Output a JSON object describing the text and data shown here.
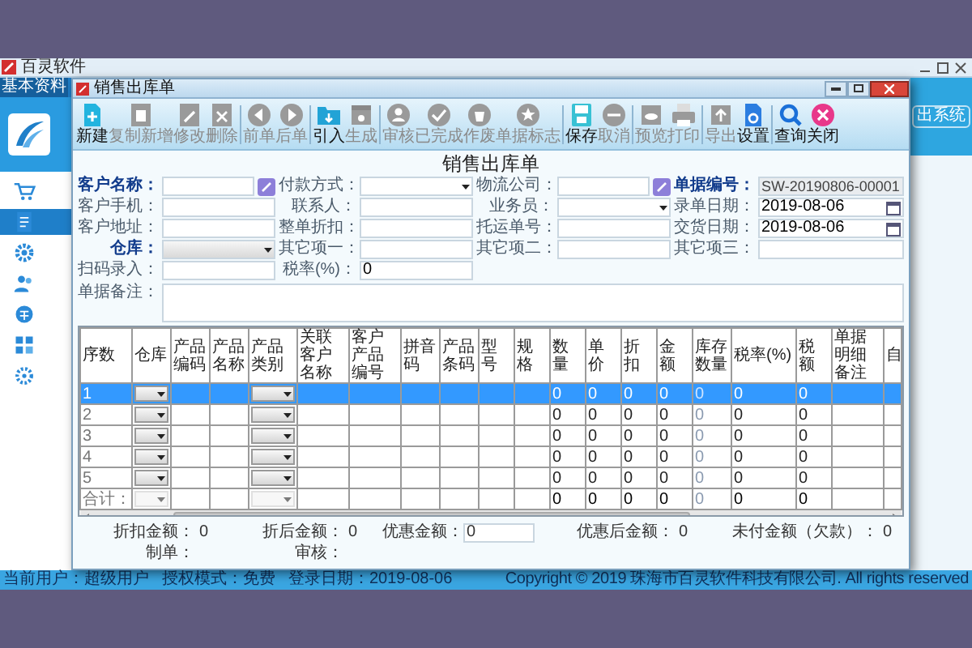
{
  "app": {
    "title": "百灵软件",
    "tab": "基本资料",
    "exit_button": "出系统",
    "sidebar": {
      "items": [
        {
          "selected": false
        },
        {
          "selected": true
        },
        {
          "selected": false
        },
        {
          "selected": false
        },
        {
          "selected": false
        },
        {
          "selected": false
        },
        {
          "selected": false
        }
      ]
    },
    "status_bar": {
      "user": "当前用户：超级用户",
      "mode": "授权模式：免费",
      "login": "登录日期：2019-08-06",
      "copyright": "Copyright © 2019 珠海市百灵软件科技有限公司. All rights reserved"
    }
  },
  "dialog": {
    "title": "销售出库单",
    "toolbar": [
      [
        {
          "label": "新建",
          "disabled": false
        },
        {
          "label": "复制新增",
          "disabled": true
        },
        {
          "label": "修改",
          "disabled": true
        },
        {
          "label": "删除",
          "disabled": true
        }
      ],
      [
        {
          "label": "前单",
          "disabled": true
        },
        {
          "label": "后单",
          "disabled": true
        }
      ],
      [
        {
          "label": "引入",
          "disabled": false
        },
        {
          "label": "生成",
          "disabled": true
        }
      ],
      [
        {
          "label": "审核",
          "disabled": true
        },
        {
          "label": "已完成",
          "disabled": true
        },
        {
          "label": "作废",
          "disabled": true
        },
        {
          "label": "单据标志",
          "disabled": true
        }
      ],
      [
        {
          "label": "保存",
          "disabled": false
        },
        {
          "label": "取消",
          "disabled": true
        }
      ],
      [
        {
          "label": "预览",
          "disabled": true
        },
        {
          "label": "打印",
          "disabled": true
        }
      ],
      [
        {
          "label": "导出",
          "disabled": true
        },
        {
          "label": "设置",
          "disabled": false
        }
      ],
      [
        {
          "label": "查询",
          "disabled": false
        },
        {
          "label": "关闭",
          "disabled": false
        }
      ]
    ],
    "form_title": "销售出库单",
    "fields": [
      {
        "label": "客户名称：",
        "kind": "lookup",
        "required": true
      },
      {
        "label": "付款方式：",
        "kind": "select",
        "required": false
      },
      {
        "label": "物流公司：",
        "kind": "lookup",
        "required": false
      },
      {
        "label": "单据编号：",
        "kind": "readonly",
        "value": "SW-20190806-00001",
        "required": true
      },
      {
        "label": "客户手机：",
        "kind": "text",
        "required": false
      },
      {
        "label": "联系人：",
        "kind": "text",
        "required": false
      },
      {
        "label": "业务员：",
        "kind": "select",
        "required": false
      },
      {
        "label": "录单日期：",
        "kind": "date",
        "value": "2019-08-06",
        "required": false
      },
      {
        "label": "客户地址：",
        "kind": "text",
        "required": false
      },
      {
        "label": "整单折扣：",
        "kind": "text",
        "required": false
      },
      {
        "label": "托运单号：",
        "kind": "text",
        "required": false
      },
      {
        "label": "交货日期：",
        "kind": "date",
        "value": "2019-08-06",
        "required": false
      },
      {
        "label": "仓库：",
        "kind": "combo",
        "required": true
      },
      {
        "label": "其它项一：",
        "kind": "text",
        "required": false
      },
      {
        "label": "其它项二：",
        "kind": "text",
        "required": false
      },
      {
        "label": "其它项三：",
        "kind": "text",
        "required": false
      },
      {
        "label": "扫码录入：",
        "kind": "text",
        "required": false
      },
      {
        "label": "税率(%)：",
        "kind": "text",
        "value": "0",
        "required": false
      }
    ],
    "remark": {
      "label": "单据备注："
    },
    "table": {
      "columns": [
        "序数",
        "仓库",
        "产品编码",
        "产品名称",
        "产品类别",
        "关联客户名称",
        "客户产品编号",
        "拼音码",
        "产品条码",
        "型号",
        "规格",
        "数量",
        "单价",
        "折扣",
        "金额",
        "库存数量",
        "税率(%)",
        "税额",
        "单据明细备注",
        "自"
      ],
      "rows": [
        {
          "number": "1",
          "selected": true,
          "quantity": "0",
          "unit_price": "0",
          "discount": "0",
          "amount": "0",
          "stock": "0",
          "tax_rate": "0",
          "tax": "0"
        },
        {
          "number": "2",
          "selected": false,
          "quantity": "0",
          "unit_price": "0",
          "discount": "0",
          "amount": "0",
          "stock": "0",
          "tax_rate": "0",
          "tax": "0"
        },
        {
          "number": "3",
          "selected": false,
          "quantity": "0",
          "unit_price": "0",
          "discount": "0",
          "amount": "0",
          "stock": "0",
          "tax_rate": "0",
          "tax": "0"
        },
        {
          "number": "4",
          "selected": false,
          "quantity": "0",
          "unit_price": "0",
          "discount": "0",
          "amount": "0",
          "stock": "0",
          "tax_rate": "0",
          "tax": "0"
        },
        {
          "number": "5",
          "selected": false,
          "quantity": "0",
          "unit_price": "0",
          "discount": "0",
          "amount": "0",
          "stock": "0",
          "tax_rate": "0",
          "tax": "0"
        }
      ],
      "total_row": {
        "label": "合计：",
        "quantity": "0",
        "unit_price": "0",
        "discount": "0",
        "amount": "0",
        "stock": "0",
        "tax_rate": "0",
        "tax": "0"
      }
    },
    "summary": [
      {
        "label": "折扣金额：",
        "value": "0",
        "kind": "text"
      },
      {
        "label": "折后金额：",
        "value": "0",
        "kind": "text"
      },
      {
        "label": "优惠金额：",
        "value": "0",
        "kind": "input"
      },
      {
        "label": "优惠后金额：",
        "value": "0",
        "kind": "text"
      },
      {
        "label": "未付金额（欠款）：",
        "value": "0",
        "kind": "text"
      }
    ],
    "signatures": [
      {
        "label": "制单："
      },
      {
        "label": "审核："
      }
    ]
  }
}
